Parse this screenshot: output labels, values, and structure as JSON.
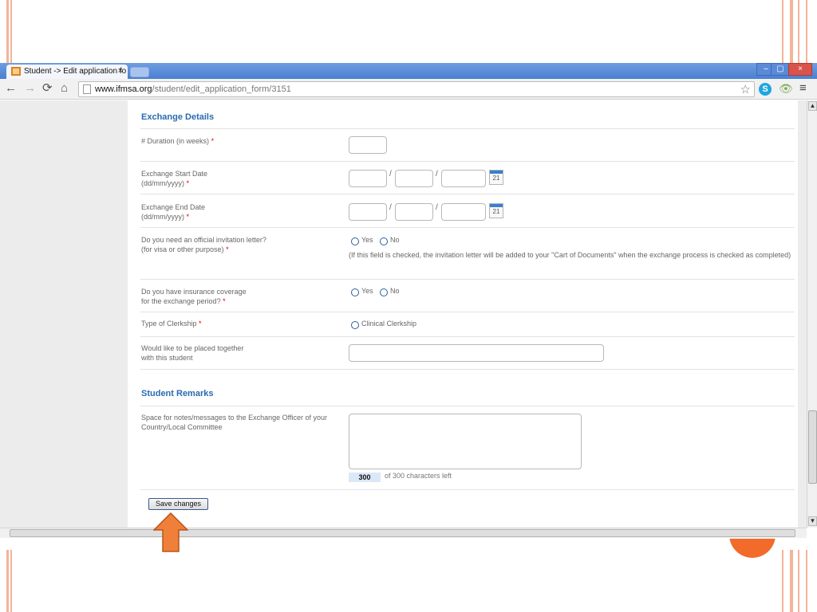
{
  "browser": {
    "tab_title": "Student -> Edit application fo",
    "tab_close": "×",
    "window_buttons": [
      "–",
      "▢",
      "×"
    ],
    "nav": {
      "back": "←",
      "forward": "→",
      "reload": "⟳",
      "home": "⌂"
    },
    "url_host": "www.ifmsa.org",
    "url_path": "/student/edit_application_form/3151",
    "star_icon": "☆",
    "skype_letter": "S",
    "eye_icon": "👁",
    "menu_icon": "≡"
  },
  "form": {
    "exchange_section_title": "Exchange Details",
    "duration": {
      "label": "# Duration (in weeks)",
      "required": "*"
    },
    "start_date": {
      "label_line1": "Exchange Start Date",
      "label_line2": "(dd/mm/yyyy)",
      "required": "*",
      "separator": "/",
      "calendar_day": "21"
    },
    "end_date": {
      "label_line1": "Exchange End Date",
      "label_line2": "(dd/mm/yyyy)",
      "required": "*",
      "separator": "/",
      "calendar_day": "21"
    },
    "invitation": {
      "label_line1": "Do you need an official invitation letter?",
      "label_line2": "(for visa or other purpose)",
      "required": "*",
      "opt_yes": "Yes",
      "opt_no": "No",
      "note": "(If this field is checked, the invitation letter will be added to your \"Cart of Documents\" when the exchange process is checked as completed)"
    },
    "insurance": {
      "label_line1": "Do you have insurance coverage",
      "label_line2": "for the exchange period?",
      "required": "*",
      "opt_yes": "Yes",
      "opt_no": "No"
    },
    "clerkship": {
      "label": "Type of Clerkship",
      "required": "*",
      "option": "Clinical Clerkship"
    },
    "placed_together": {
      "label_line1": "Would like to be placed together",
      "label_line2": "with this student",
      "value": ""
    },
    "remarks_section_title": "Student Remarks",
    "remarks": {
      "label_line1": "Space for notes/messages to the Exchange Officer of your",
      "label_line2": "Country/Local Committee",
      "value": "",
      "chars_left": "300",
      "chars_text": "of 300 characters left"
    },
    "save_label": "Save changes"
  },
  "colors": {
    "section_title": "#2a6bb0",
    "annotation_arrow": "#f07f3a",
    "slide_accent": "#f4b49a"
  }
}
